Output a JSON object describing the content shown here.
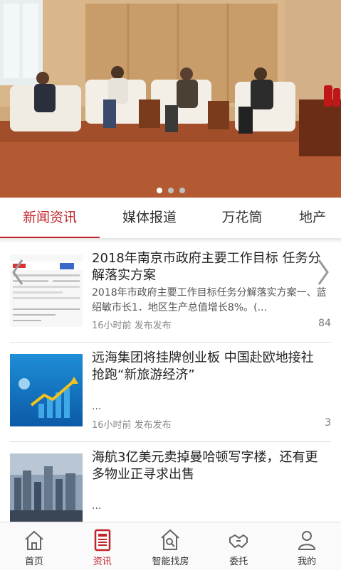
{
  "banner": {
    "slides": 3,
    "active_slide": 1
  },
  "tabs": [
    {
      "label": "新闻资讯",
      "active": true
    },
    {
      "label": "媒体报道",
      "active": false
    },
    {
      "label": "万花筒",
      "active": false
    },
    {
      "label": "地产",
      "active": false
    }
  ],
  "news": [
    {
      "title": "2018年南京市政府主要工作目标 任务分解落实方案",
      "summary": "2018年市政府主要工作目标任务分解落实方案一、蓝绍敏市长1．地区生产总值增长8%。(...",
      "meta": "16小时前 发布发布",
      "count": "84"
    },
    {
      "title": "远海集团将挂牌创业板 中国赴欧地接社 抢跑“新旅游经济”",
      "summary": "...",
      "meta": "16小时前 发布发布",
      "count": "3"
    },
    {
      "title": "海航3亿美元卖掉曼哈顿写字楼，还有更多物业正寻求出售",
      "summary": "...",
      "meta": "",
      "count": ""
    }
  ],
  "bottom_nav": [
    {
      "label": "首页",
      "icon": "home-icon",
      "active": false
    },
    {
      "label": "资讯",
      "icon": "news-icon",
      "active": true
    },
    {
      "label": "智能找房",
      "icon": "house-search-icon",
      "active": false
    },
    {
      "label": "委托",
      "icon": "handshake-icon",
      "active": false
    },
    {
      "label": "我的",
      "icon": "user-icon",
      "active": false
    }
  ],
  "colors": {
    "accent": "#c0242b"
  }
}
